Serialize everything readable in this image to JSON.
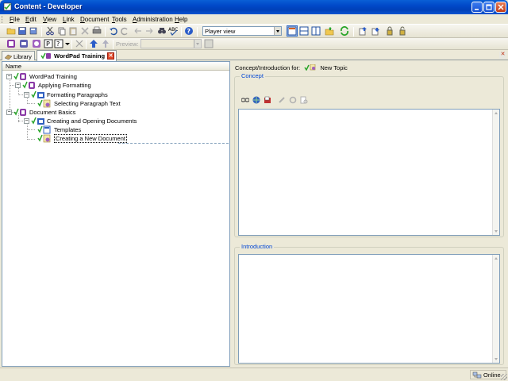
{
  "window": {
    "title": "Content - Developer"
  },
  "menubar": {
    "items": [
      {
        "key": "F",
        "rest": "ile"
      },
      {
        "key": "E",
        "rest": "dit"
      },
      {
        "key": "V",
        "rest": "iew"
      },
      {
        "key": "L",
        "rest": "ink"
      },
      {
        "key": "D",
        "rest": "ocument"
      },
      {
        "key": "T",
        "rest": "ools"
      },
      {
        "key": "A",
        "rest": "dministration"
      },
      {
        "key": "H",
        "rest": "elp"
      }
    ]
  },
  "toolbar": {
    "view_mode_value": "Player view",
    "preview_label": "Preview:",
    "preview_value": ""
  },
  "tabs": {
    "library_label": "Library",
    "document_label": "WordPad Training"
  },
  "outline": {
    "column_header": "Name",
    "nodes": [
      {
        "label": "WordPad Training",
        "type": "module"
      },
      {
        "label": "Applying Formatting",
        "type": "section"
      },
      {
        "label": "Formatting Paragraphs",
        "type": "topic-group"
      },
      {
        "label": "Selecting Paragraph Text",
        "type": "topic"
      },
      {
        "label": "Document Basics",
        "type": "section"
      },
      {
        "label": "Creating and Opening Documents",
        "type": "topic-group"
      },
      {
        "label": "Templates",
        "type": "web-page"
      },
      {
        "label": "Creating a New Document",
        "type": "topic"
      }
    ]
  },
  "properties_pane": {
    "header_prefix": "Concept/Introduction for:",
    "header_item": "New Topic",
    "concept_legend": "Concept",
    "introduction_legend": "Introduction",
    "concept_text": "",
    "introduction_text": ""
  },
  "statusbar": {
    "connection_status": "Online"
  },
  "colors": {
    "titlebar": "#0a55d0",
    "accent_blue": "#316ac5",
    "legend_blue": "#0046d5",
    "check_green": "#2aa52a",
    "module_purple": "#8a3aa6"
  }
}
